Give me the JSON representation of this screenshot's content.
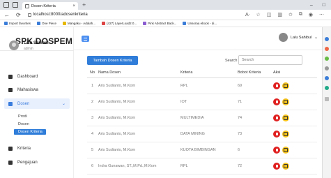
{
  "browser": {
    "tab_title": "Dosen Kriteria",
    "url": "localhost:8000/adosenkriteria",
    "bookmarks": [
      "Import favorites",
      "One Piece",
      "Mangaku - Adalah...",
      "(427) LayerLoad2.0...",
      "Pink Abstract Back...",
      "Unsoraa ebook - di..."
    ]
  },
  "app": {
    "brand": "SPK DOSPEM",
    "user": {
      "name": "Lalu Sahibul",
      "role": "admin"
    },
    "menu": [
      {
        "label": "Dashboard"
      },
      {
        "label": "Mahasiswa"
      },
      {
        "label": "Dosen",
        "active": true
      },
      {
        "label": "Kriteria"
      },
      {
        "label": "Pengajuan"
      }
    ],
    "submenu": [
      "Prodi",
      "Dosen",
      "Dosen Kriteria"
    ],
    "topbar_user": "Lalu Sahibul",
    "add_button": "Tambah Dosen Kriteria",
    "search_label": "Search",
    "table": {
      "headers": [
        "No",
        "Nama Dosen",
        "Kriteria",
        "Bobot Kriteria",
        "Aksi"
      ],
      "rows": [
        {
          "no": "1",
          "nama": "Aris Sudianto, M.Kom",
          "kriteria": "RPL",
          "bobot": "69"
        },
        {
          "no": "2",
          "nama": "Aris Sudianto, M.Kom",
          "kriteria": "IOT",
          "bobot": "71"
        },
        {
          "no": "3",
          "nama": "Aris Sudianto, M.Kom",
          "kriteria": "MULTIMEDIA",
          "bobot": "74"
        },
        {
          "no": "4",
          "nama": "Aris Sudianto, M.Kom",
          "kriteria": "DATA MINING",
          "bobot": "73"
        },
        {
          "no": "5",
          "nama": "Aris Sudianto, M.Kom",
          "kriteria": "KUOTA BIMBINGAN",
          "bobot": "6"
        },
        {
          "no": "6",
          "nama": "Indra Gunawan, ST.,M.Pd.,M.Kom",
          "kriteria": "RPL",
          "bobot": "72"
        }
      ]
    }
  },
  "colors": {
    "primary": "#2f7dd9",
    "danger": "#e02020",
    "warning": "#f5c21b"
  }
}
